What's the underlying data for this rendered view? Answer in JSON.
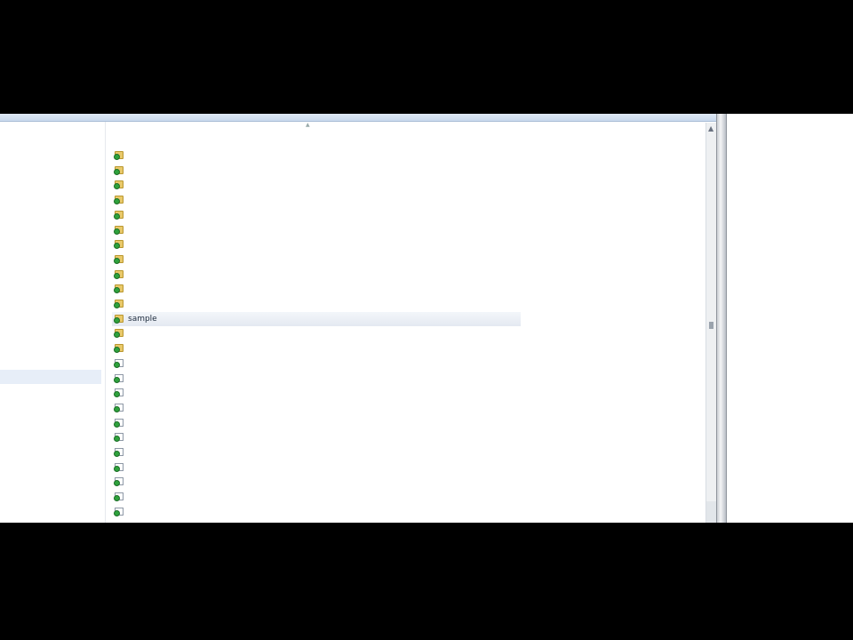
{
  "toolbar": {
    "items": [
      "",
      "",
      "",
      "",
      ""
    ]
  },
  "nav": {
    "items": [
      {
        "label": "",
        "selected": true
      },
      {
        "label": ""
      },
      {
        "label": ""
      },
      {
        "label": ""
      },
      {
        "label": ""
      },
      {
        "label": ""
      }
    ]
  },
  "columns": {
    "name": "",
    "date": "",
    "type": "",
    "size": ""
  },
  "rows": [
    {
      "name": "",
      "date": "",
      "type": "",
      "size": "",
      "kind": "folder"
    },
    {
      "name": "",
      "date": "",
      "type": "",
      "size": "",
      "kind": "folder"
    },
    {
      "name": "",
      "date": "",
      "type": "",
      "size": "",
      "kind": "folder"
    },
    {
      "name": "",
      "date": "",
      "type": "",
      "size": "",
      "kind": "folder"
    },
    {
      "name": "",
      "date": "",
      "type": "",
      "size": "",
      "kind": "folder"
    },
    {
      "name": "",
      "date": "",
      "type": "",
      "size": "",
      "kind": "folder"
    },
    {
      "name": "",
      "date": "",
      "type": "",
      "size": "",
      "kind": "folder"
    },
    {
      "name": "",
      "date": "",
      "type": "",
      "size": "",
      "kind": "folder"
    },
    {
      "name": "",
      "date": "",
      "type": "",
      "size": "",
      "kind": "folder"
    },
    {
      "name": "",
      "date": "",
      "type": "",
      "size": "",
      "kind": "folder"
    },
    {
      "name": "",
      "date": "",
      "type": "",
      "size": "",
      "kind": "folder"
    },
    {
      "name": "sample",
      "date": "",
      "type": "",
      "size": "",
      "kind": "folder"
    },
    {
      "name": "",
      "date": "",
      "type": "",
      "size": "",
      "kind": "folder"
    },
    {
      "name": "",
      "date": "",
      "type": "",
      "size": "",
      "kind": "folder"
    },
    {
      "name": "",
      "date": "",
      "type": "",
      "size": "",
      "kind": "doc"
    },
    {
      "name": "",
      "date": "",
      "type": "",
      "size": "",
      "kind": "doc"
    },
    {
      "name": "",
      "date": "",
      "type": "",
      "size": "",
      "kind": "doc"
    },
    {
      "name": "",
      "date": "",
      "type": "",
      "size": "",
      "kind": "doc"
    },
    {
      "name": "",
      "date": "",
      "type": "",
      "size": "",
      "kind": "doc"
    },
    {
      "name": "",
      "date": "",
      "type": "",
      "size": "",
      "kind": "doc"
    },
    {
      "name": "",
      "date": "",
      "type": "",
      "size": "",
      "kind": "doc"
    },
    {
      "name": "",
      "date": "",
      "type": "",
      "size": "",
      "kind": "doc"
    },
    {
      "name": "",
      "date": "",
      "type": "",
      "size": "",
      "kind": "doc"
    },
    {
      "name": "",
      "date": "",
      "type": "",
      "size": "",
      "kind": "doc"
    },
    {
      "name": "",
      "date": "",
      "type": "",
      "size": "",
      "kind": "doc"
    }
  ]
}
